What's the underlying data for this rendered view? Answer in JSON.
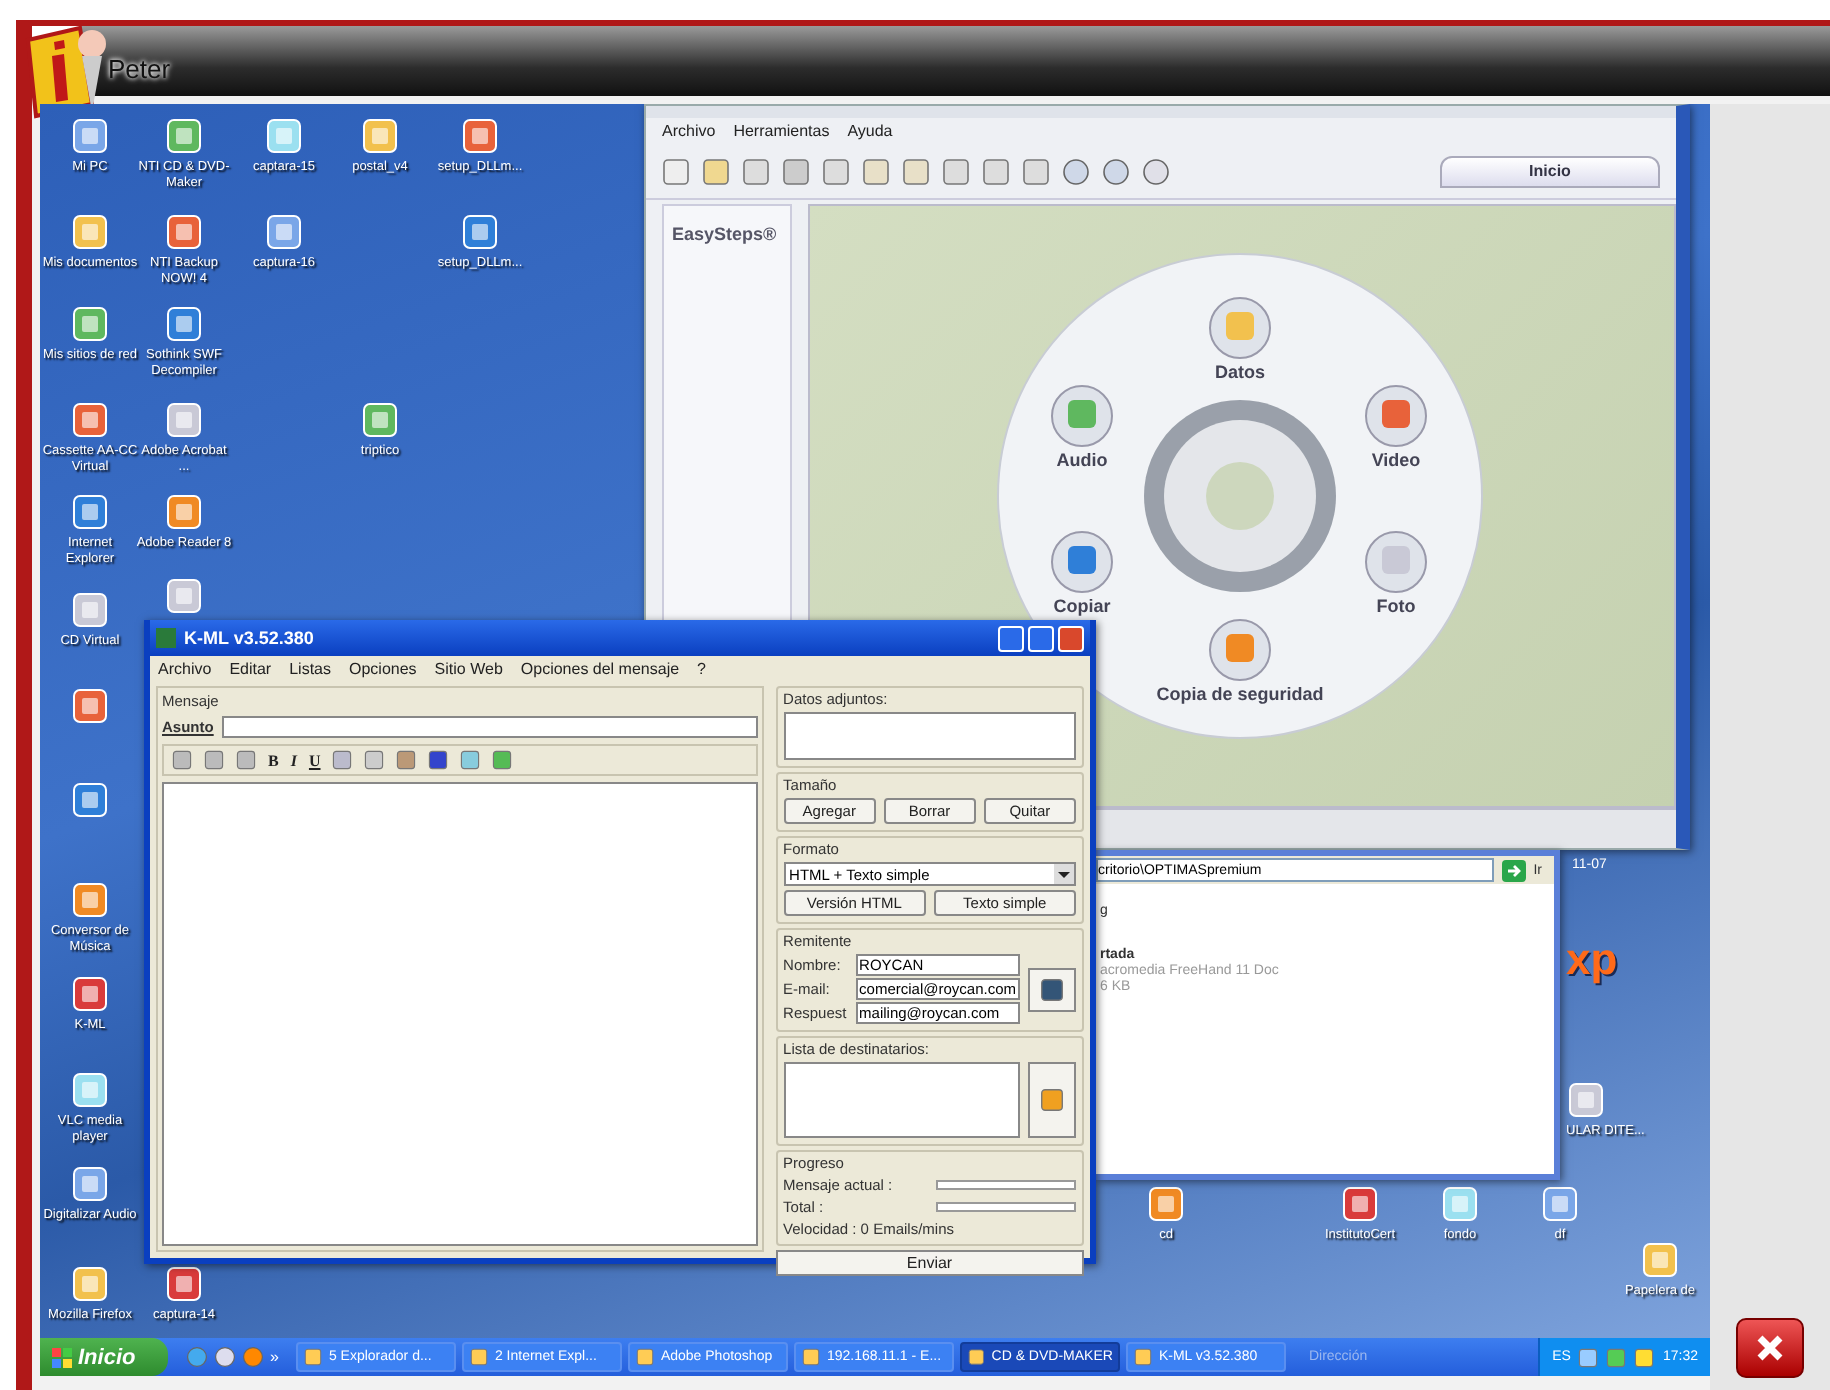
{
  "frame": {
    "title": "Peter"
  },
  "desktop": {
    "icons": [
      {
        "label": "Mi PC"
      },
      {
        "label": "Mis documentos"
      },
      {
        "label": "Mis sitios de red"
      },
      {
        "label": "Cassette AA-CC Virtual"
      },
      {
        "label": "Internet Explorer"
      },
      {
        "label": "CD Virtual"
      },
      {
        "label": "Conversor de Música"
      },
      {
        "label": "K-ML"
      },
      {
        "label": "VLC media player"
      },
      {
        "label": "Digitalizar Audio"
      },
      {
        "label": "Mozilla Firefox"
      },
      {
        "label": "NTI CD & DVD-Maker"
      },
      {
        "label": "NTI Backup NOW! 4"
      },
      {
        "label": "Sothink SWF Decompiler"
      },
      {
        "label": "Adobe Acrobat ..."
      },
      {
        "label": "Adobe Reader 8"
      },
      {
        "label": "captura-14"
      },
      {
        "label": "captara-15"
      },
      {
        "label": "captura-16"
      },
      {
        "label": "postal_v4"
      },
      {
        "label": "triptico"
      },
      {
        "label": "setup_DLLm..."
      },
      {
        "label": "setup_DLLm..."
      },
      {
        "label": "ULAR DITE..."
      },
      {
        "label": "cd"
      },
      {
        "label": "InstitutoCert"
      },
      {
        "label": "fondo"
      },
      {
        "label": "df"
      },
      {
        "label": "Papelera de"
      }
    ],
    "wallpaper_text": "xp",
    "date_fragment": "11-07"
  },
  "cd_maker": {
    "menu": [
      "Archivo",
      "Herramientas",
      "Ayuda"
    ],
    "tab": "Inicio",
    "sidebar_title": "EasySteps®",
    "disc_items": [
      "Datos",
      "Audio",
      "Video",
      "Copiar",
      "Foto",
      "Copia de seguridad"
    ]
  },
  "explorer": {
    "address": "critorio\\OPTIMASpremium",
    "go": "Ir",
    "lines": [
      "g",
      "rtada",
      "acromedia FreeHand 11 Doc",
      "6 KB"
    ]
  },
  "kml": {
    "title": "K-ML v3.52.380",
    "menu": [
      "Archivo",
      "Editar",
      "Listas",
      "Opciones",
      "Sitio Web",
      "Opciones del mensaje",
      "?"
    ],
    "message_label": "Mensaje",
    "subject_label": "Asunto",
    "format_tools": [
      "B",
      "I",
      "U"
    ],
    "attachments_label": "Datos adjuntos:",
    "size_label": "Tamaño",
    "attachment_buttons": [
      "Agregar",
      "Borrar",
      "Quitar"
    ],
    "format_label": "Formato",
    "format_value": "HTML + Texto simple",
    "format_buttons": [
      "Versión HTML",
      "Texto simple"
    ],
    "sender": {
      "label": "Remitente",
      "fields": [
        {
          "label": "Nombre:",
          "value": "ROYCAN"
        },
        {
          "label": "E-mail:",
          "value": "comercial@roycan.com"
        },
        {
          "label": "Respuest",
          "value": "mailing@roycan.com"
        }
      ]
    },
    "recipients_label": "Lista de destinatarios:",
    "progress": {
      "label": "Progreso",
      "rows": [
        {
          "label": "Mensaje actual :",
          "level": 0
        },
        {
          "label": "Total :",
          "level": 0
        }
      ],
      "speed": "Velocidad : 0 Emails/mins"
    },
    "send_button": "Enviar"
  },
  "taskbar": {
    "start": "Inicio",
    "more": "»",
    "tasks": [
      {
        "label": "5 Explorador d...",
        "selected": false
      },
      {
        "label": "2 Internet Expl...",
        "selected": false
      },
      {
        "label": "Adobe Photoshop",
        "selected": false
      },
      {
        "label": "192.168.11.1 - E...",
        "selected": false
      },
      {
        "label": "CD & DVD-MAKER",
        "selected": true
      },
      {
        "label": "K-ML v3.52.380",
        "selected": false
      }
    ],
    "address_label": "Dirección",
    "language": "ES",
    "clock": "17:32"
  }
}
